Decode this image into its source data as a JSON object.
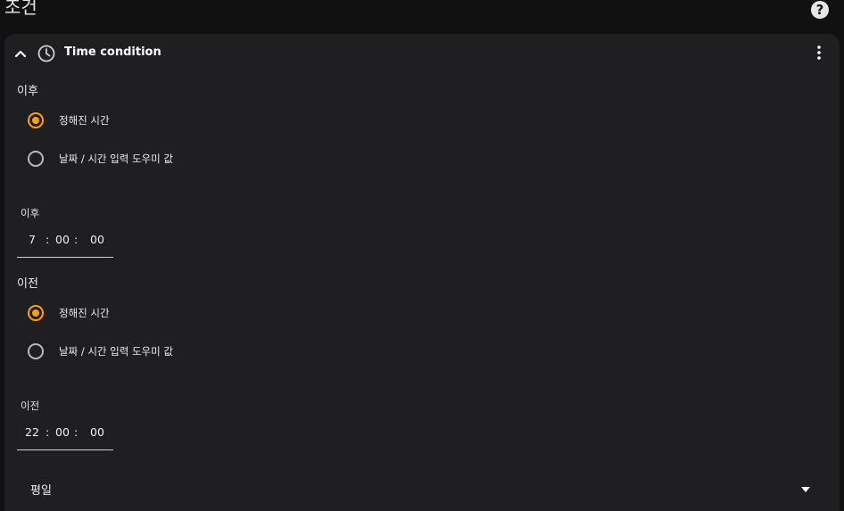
{
  "page": {
    "section_title": "조건",
    "help_icon": "help-circle-icon"
  },
  "card": {
    "title": "Time condition",
    "collapse_icon": "chevron-up-icon",
    "title_icon": "clock-icon",
    "menu_icon": "more-vertical-icon",
    "after": {
      "group_label": "이후",
      "options": [
        {
          "label": "정해진 시간",
          "checked": true
        },
        {
          "label": "날짜 / 시간 입력 도우미 값",
          "checked": false
        }
      ],
      "time_field": {
        "label": "이후",
        "hours": "7",
        "minutes": "00",
        "seconds": "00",
        "separator": ":"
      }
    },
    "before": {
      "group_label": "이전",
      "options": [
        {
          "label": "정해진 시간",
          "checked": true
        },
        {
          "label": "날짜 / 시간 입력 도우미 값",
          "checked": false
        }
      ],
      "time_field": {
        "label": "이전",
        "hours": "22",
        "minutes": "00",
        "seconds": "00",
        "separator": ":"
      }
    },
    "weekdays": {
      "value": "평일",
      "icon": "caret-down-icon"
    }
  },
  "colors": {
    "accent": "#ff9f0f",
    "card_background": "#1f1f21",
    "page_background": "#111111"
  }
}
